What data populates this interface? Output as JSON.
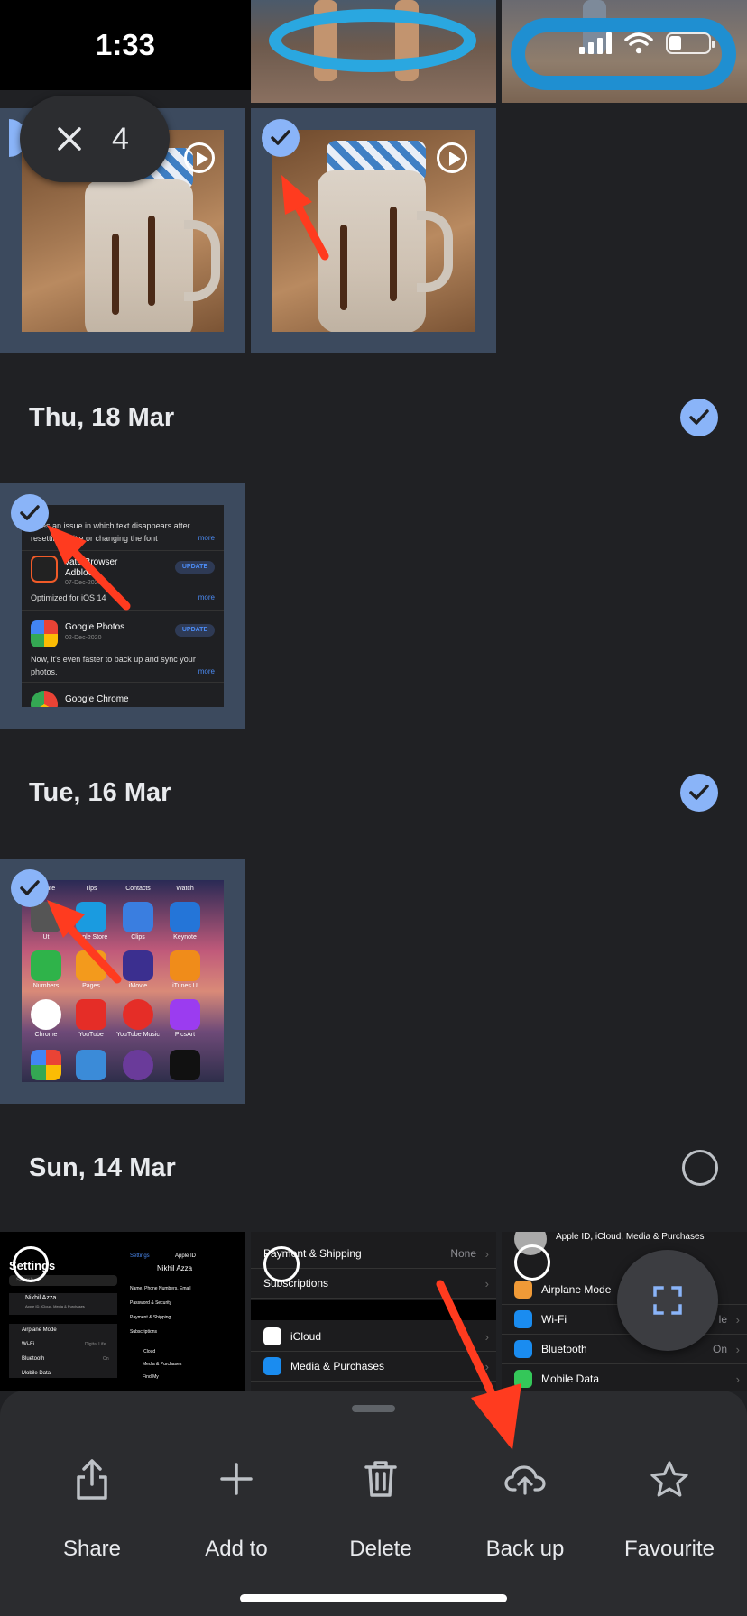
{
  "status_bar": {
    "time": "1:33"
  },
  "selection": {
    "count": "4"
  },
  "sections": [
    {
      "date": "Thu, 18 Mar",
      "selected": true
    },
    {
      "date": "Tue, 16 Mar",
      "selected": true
    },
    {
      "date": "Sun, 14 Mar",
      "selected": false
    }
  ],
  "appstore_screenshot": {
    "note_text_1": "Fixes an issue in which text disappears after",
    "note_text_2": "resetting a title or changing the font",
    "more": "more",
    "app1_name_1": "vate Browser",
    "app1_name_2": "Adblock",
    "app1_date": "07-Dec-2020",
    "app1_note": "Optimized for iOS 14",
    "update": "UPDATE",
    "app2_name": "Google Photos",
    "app2_date": "02-Dec-2020",
    "app2_note_1": "Now, it's even faster to back up and sync your",
    "app2_note_2": "photos.",
    "app3_name": "Google Chrome"
  },
  "home_screenshot": {
    "row0": [
      "lculate",
      "Tips",
      "Contacts",
      "Watch"
    ],
    "row1": [
      "Ut",
      "Apple Store",
      "Clips",
      "Keynote"
    ],
    "row2": [
      "Numbers",
      "Pages",
      "iMovie",
      "iTunes U"
    ],
    "row3": [
      "Chrome",
      "YouTube",
      "YouTube Music",
      "PicsArt"
    ]
  },
  "settings_screenshots": {
    "title": "Settings",
    "search": "Search",
    "name": "Nikhil Azza",
    "apple_id_sub": "Apple ID, iCloud, Media & Purchases",
    "airplane": "Airplane Mode",
    "wifi": "Wi-Fi",
    "wifi_val": "Digital Life",
    "bluetooth": "Bluetooth",
    "bluetooth_val": "On",
    "mobile_data": "Mobile Data",
    "apple_id_title": "Apple ID",
    "back": "Settings",
    "name_phone": "Name, Phone Numbers, Email",
    "password": "Password & Security",
    "payment": "Payment & Shipping",
    "payment_val": "None",
    "subscriptions": "Subscriptions",
    "icloud": "iCloud",
    "media": "Media & Purchases",
    "find_my": "Find My",
    "wifi_val_cut": "le"
  },
  "actions": [
    {
      "label": "Share",
      "icon": "share-icon"
    },
    {
      "label": "Add to",
      "icon": "plus-icon"
    },
    {
      "label": "Delete",
      "icon": "trash-icon"
    },
    {
      "label": "Back up",
      "icon": "cloud-upload-icon"
    },
    {
      "label": "Favourite",
      "icon": "star-icon"
    }
  ],
  "colors": {
    "background": "#202124",
    "selected_tile": "#3c4a5e",
    "accent_check": "#8ab4f8",
    "annotation_arrow": "#ff3b1f"
  }
}
